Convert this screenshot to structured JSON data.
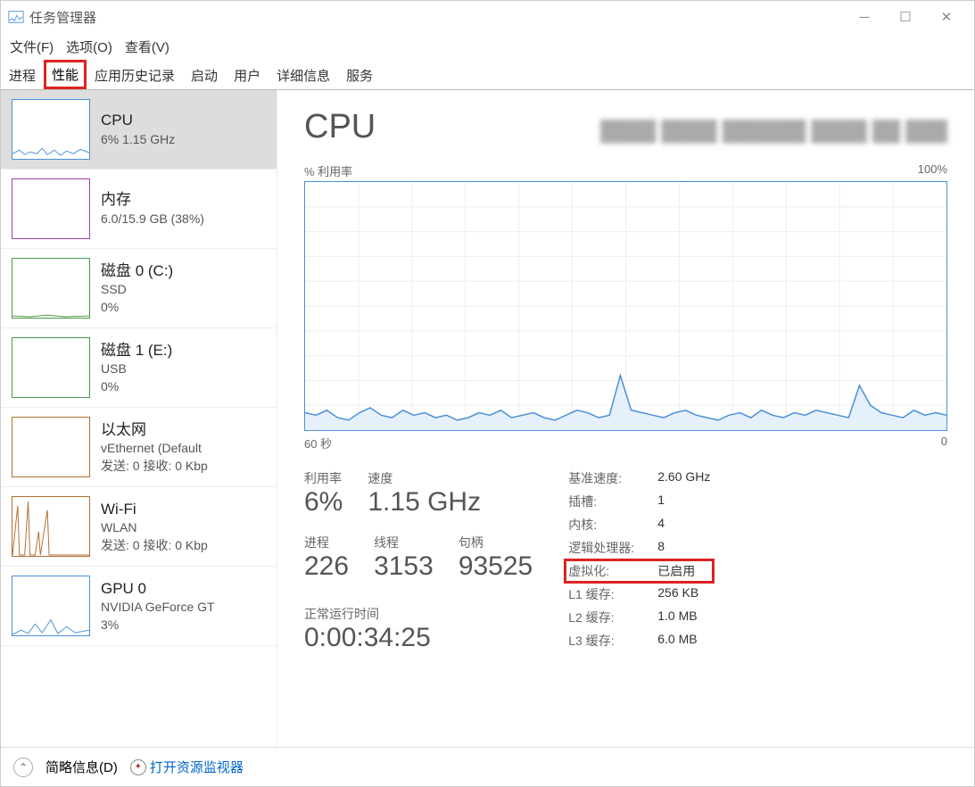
{
  "window": {
    "title": "任务管理器"
  },
  "menu": {
    "file": "文件(F)",
    "options": "选项(O)",
    "view": "查看(V)"
  },
  "tabs": {
    "processes": "进程",
    "performance": "性能",
    "history": "应用历史记录",
    "startup": "启动",
    "users": "用户",
    "details": "详细信息",
    "services": "服务"
  },
  "sidebar": {
    "cpu": {
      "title": "CPU",
      "sub": "6%  1.15 GHz"
    },
    "mem": {
      "title": "内存",
      "sub": "6.0/15.9 GB (38%)"
    },
    "disk0": {
      "title": "磁盘 0 (C:)",
      "sub1": "SSD",
      "sub2": "0%"
    },
    "disk1": {
      "title": "磁盘 1 (E:)",
      "sub1": "USB",
      "sub2": "0%"
    },
    "eth": {
      "title": "以太网",
      "sub1": "vEthernet (Default",
      "sub2": "发送: 0 接收: 0 Kbp"
    },
    "wifi": {
      "title": "Wi-Fi",
      "sub1": "WLAN",
      "sub2": "发送: 0 接收: 0 Kbp"
    },
    "gpu": {
      "title": "GPU 0",
      "sub1": "NVIDIA GeForce GT",
      "sub2": "3%"
    }
  },
  "main": {
    "title": "CPU",
    "chart_top_left": "% 利用率",
    "chart_top_right": "100%",
    "chart_bottom_left": "60 秒",
    "chart_bottom_right": "0",
    "stats": {
      "util_label": "利用率",
      "util_val": "6%",
      "speed_label": "速度",
      "speed_val": "1.15 GHz",
      "proc_label": "进程",
      "proc_val": "226",
      "thread_label": "线程",
      "thread_val": "3153",
      "handle_label": "句柄",
      "handle_val": "93525",
      "uptime_label": "正常运行时间",
      "uptime_val": "0:00:34:25"
    },
    "details": {
      "base_speed_k": "基准速度:",
      "base_speed_v": "2.60 GHz",
      "sockets_k": "插槽:",
      "sockets_v": "1",
      "cores_k": "内核:",
      "cores_v": "4",
      "logical_k": "逻辑处理器:",
      "logical_v": "8",
      "virt_k": "虚拟化:",
      "virt_v": "已启用",
      "l1_k": "L1 缓存:",
      "l1_v": "256 KB",
      "l2_k": "L2 缓存:",
      "l2_v": "1.0 MB",
      "l3_k": "L3 缓存:",
      "l3_v": "6.0 MB"
    }
  },
  "footer": {
    "simple": "简略信息(D)",
    "resmon": "打开资源监视器"
  },
  "chart_data": {
    "type": "line",
    "title": "% 利用率",
    "xlabel": "60 秒",
    "ylabel": "",
    "ylim": [
      0,
      100
    ],
    "xrange": [
      60,
      0
    ],
    "series": [
      {
        "name": "CPU",
        "values": [
          7,
          6,
          8,
          5,
          4,
          7,
          9,
          6,
          5,
          8,
          6,
          7,
          5,
          6,
          4,
          5,
          7,
          6,
          8,
          5,
          6,
          7,
          5,
          4,
          6,
          8,
          7,
          5,
          6,
          22,
          8,
          7,
          6,
          5,
          7,
          8,
          6,
          5,
          4,
          6,
          7,
          5,
          8,
          6,
          5,
          7,
          6,
          8,
          7,
          6,
          5,
          18,
          10,
          7,
          6,
          5,
          8,
          6,
          7,
          6
        ]
      }
    ]
  }
}
